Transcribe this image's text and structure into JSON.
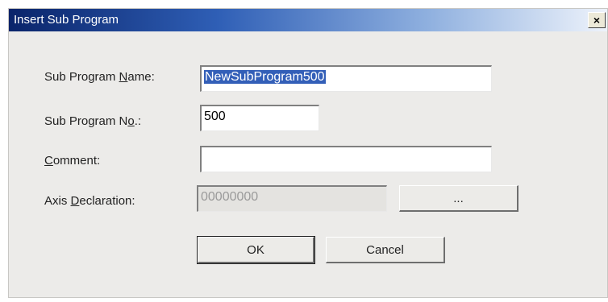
{
  "window": {
    "title": "Insert Sub Program",
    "close_label": "×"
  },
  "form": {
    "name": {
      "label_before": "Sub Program ",
      "label_key": "N",
      "label_after": "ame:",
      "value": "NewSubProgram500"
    },
    "number": {
      "label_before": "Sub Program N",
      "label_key": "o",
      "label_after": ".:",
      "value": "500"
    },
    "comment": {
      "label_before": "",
      "label_key": "C",
      "label_after": "omment:",
      "value": ""
    },
    "axis": {
      "label_before": "Axis ",
      "label_key": "D",
      "label_after": "eclaration:",
      "value": "00000000",
      "browse_label": "..."
    }
  },
  "buttons": {
    "ok_label": "OK",
    "cancel_label": "Cancel"
  }
}
